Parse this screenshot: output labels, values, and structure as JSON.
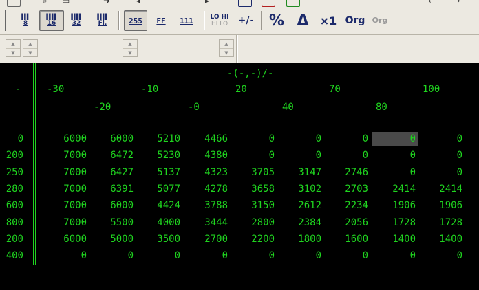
{
  "colors": {
    "grid_bg": "#000000",
    "grid_text": "#1fd41f",
    "toolbar_bg": "#ece9e1",
    "button_ink": "#1c2a6b",
    "selected_cell": "#4a4a4a"
  },
  "toolbar": {
    "bit_buttons": [
      {
        "label": "8",
        "icon": "bits-8-icon",
        "pressed": false
      },
      {
        "label": "16",
        "icon": "bits-16-icon",
        "pressed": true
      },
      {
        "label": "32",
        "icon": "bits-32-icon",
        "pressed": false
      },
      {
        "label": "Fl.",
        "icon": "bits-float-icon",
        "pressed": false
      }
    ],
    "format_buttons": [
      {
        "label": "255",
        "pressed": true
      },
      {
        "label": "FF",
        "pressed": false
      },
      {
        "label": "111",
        "pressed": false
      }
    ],
    "lohi": {
      "top": "LO HI",
      "bottom": "HI LO"
    },
    "sign_label": "+/-",
    "percent_label": "%",
    "delta_label": "Δ",
    "mult_label": "×1",
    "org_label": "Org",
    "org_gray_label": "Org"
  },
  "table": {
    "axis_title": "-(-,-)/-",
    "corner": "-",
    "columns_row1": [
      "-30",
      "-10",
      "20",
      "70",
      "100"
    ],
    "columns_row2": [
      "-20",
      "-0",
      "40",
      "80"
    ],
    "rows": [
      {
        "header": "0",
        "cells": [
          "6000",
          "6000",
          "5210",
          "4466",
          "0",
          "0",
          "0",
          "0",
          "0"
        ]
      },
      {
        "header": "200",
        "cells": [
          "7000",
          "6472",
          "5230",
          "4380",
          "0",
          "0",
          "0",
          "0",
          "0"
        ]
      },
      {
        "header": "250",
        "cells": [
          "7000",
          "6427",
          "5137",
          "4323",
          "3705",
          "3147",
          "2746",
          "0",
          "0"
        ]
      },
      {
        "header": "280",
        "cells": [
          "7000",
          "6391",
          "5077",
          "4278",
          "3658",
          "3102",
          "2703",
          "2414",
          "2414"
        ]
      },
      {
        "header": "600",
        "cells": [
          "7000",
          "6000",
          "4424",
          "3788",
          "3150",
          "2612",
          "2234",
          "1906",
          "1906"
        ]
      },
      {
        "header": "800",
        "cells": [
          "7000",
          "5500",
          "4000",
          "3444",
          "2800",
          "2384",
          "2056",
          "1728",
          "1728"
        ]
      },
      {
        "header": "200",
        "cells": [
          "6000",
          "5000",
          "3500",
          "2700",
          "2200",
          "1800",
          "1600",
          "1400",
          "1400"
        ]
      },
      {
        "header": "400",
        "cells": [
          "0",
          "0",
          "0",
          "0",
          "0",
          "0",
          "0",
          "0",
          "0"
        ]
      }
    ],
    "selected": {
      "row": 0,
      "col": 7
    }
  }
}
